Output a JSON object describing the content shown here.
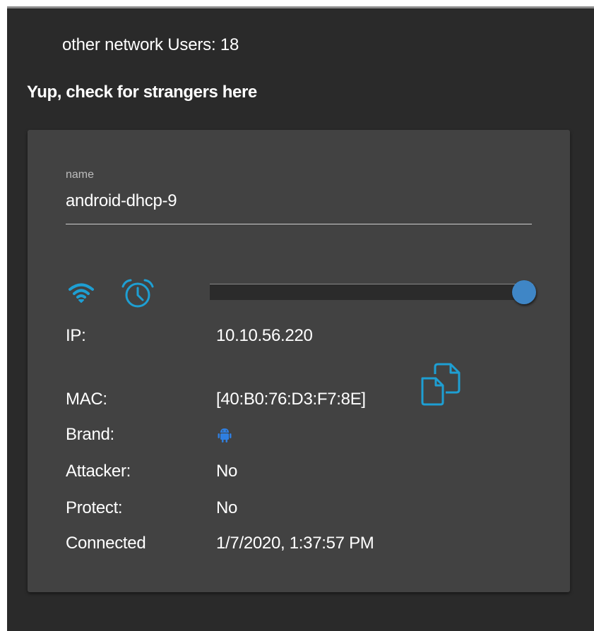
{
  "header": {
    "other_users_label": "other network Users: 18",
    "section_title": "Yup, check for strangers here"
  },
  "device_card": {
    "name_label": "name",
    "name_value": "android-dhcp-9",
    "icons": {
      "wifi": "wifi-icon",
      "alarm": "alarm-clock-icon",
      "copy": "copy-icon",
      "brand": "android-icon"
    },
    "slider_value_fraction": 1.0,
    "accent_color": "#1e9fd3",
    "slider_thumb_color": "#3f86c6",
    "fields": {
      "ip_label": "IP:",
      "ip_value": "10.10.56.220",
      "mac_label": "MAC:",
      "mac_value": "[40:B0:76:D3:F7:8E]",
      "brand_label": "Brand:",
      "attacker_label": "Attacker:",
      "attacker_value": "No",
      "protect_label": "Protect:",
      "protect_value": "No",
      "connected_label": "Connected",
      "connected_value": "1/7/2020, 1:37:57 PM"
    }
  }
}
